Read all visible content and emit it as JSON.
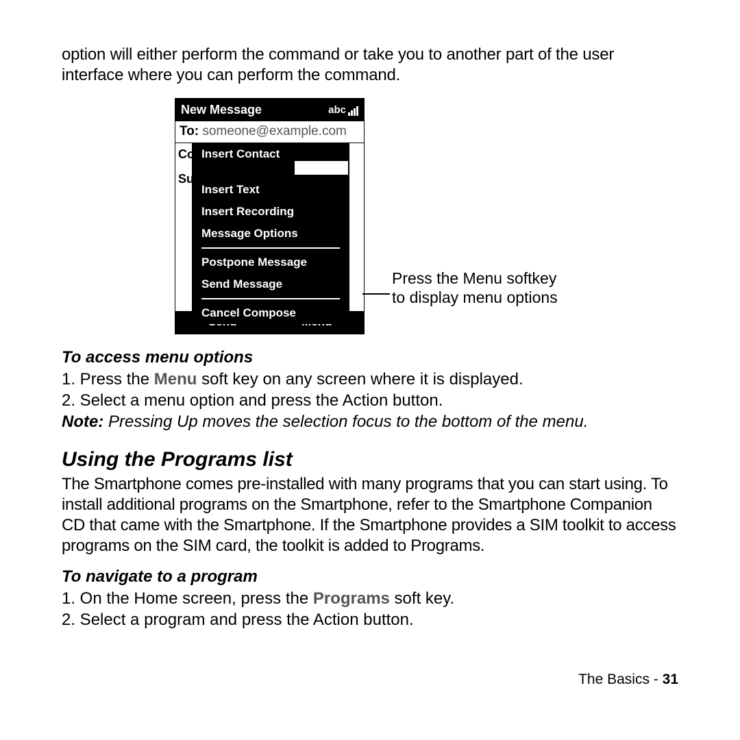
{
  "intro": "option will either perform the command or take you to another part of the user interface where you can perform the command.",
  "phone": {
    "title": "New Message",
    "abc": "abc",
    "to_label": "To:",
    "to_value": "someone@example.com",
    "cc_label": "Cc",
    "su_label": "Su",
    "menu_items_a": [
      "Insert Contact",
      "Insert Text",
      "Insert Recording",
      "Message Options"
    ],
    "menu_items_b": [
      "Postpone Message",
      "Send Message"
    ],
    "menu_items_c": [
      "Cancel Compose"
    ],
    "softkey_left": "Send",
    "softkey_right": "Menu"
  },
  "callout": {
    "line1": "Press the Menu softkey",
    "line2": "to display menu options"
  },
  "sec1": {
    "heading": "To access menu options",
    "step1_prefix": "1. Press the ",
    "step1_bold": "Menu",
    "step1_suffix": " soft key on any screen where it is displayed.",
    "step2": "2. Select a menu option and press the Action button.",
    "note_label": "Note:",
    "note_text": " Pressing Up moves the selection focus to the bottom of the menu."
  },
  "sec2": {
    "heading": "Using the Programs list",
    "para": "The Smartphone comes pre-installed with many programs that you can start using. To install additional programs on the Smartphone, refer to the Smartphone Companion CD that came with the Smartphone. If the Smartphone provides a SIM toolkit to access programs on the SIM card, the toolkit is added to Programs."
  },
  "sec3": {
    "heading": "To navigate to a program",
    "step1_prefix": "1. On the Home screen, press the ",
    "step1_bold": "Programs",
    "step1_suffix": " soft key.",
    "step2": "2. Select a program and press the Action button."
  },
  "footer": {
    "text": "The Basics - ",
    "page": "31"
  }
}
